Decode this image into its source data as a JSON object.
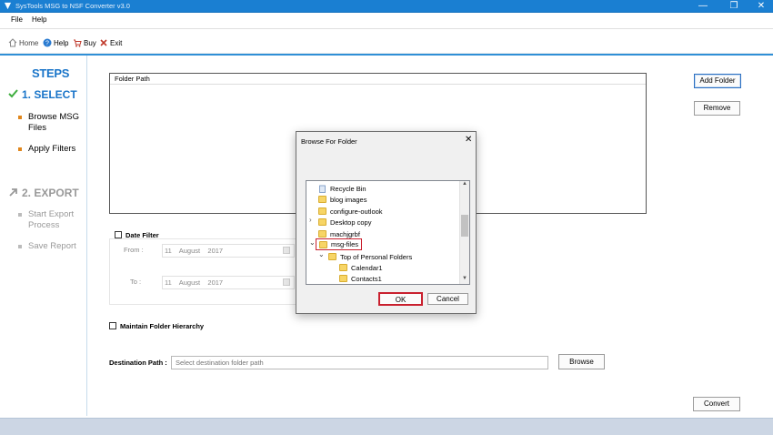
{
  "window": {
    "title": "SysTools MSG to NSF Converter v3.0",
    "controls": {
      "minimize": "—",
      "restore": "❐",
      "close": "✕"
    }
  },
  "menu": {
    "file": "File",
    "help": "Help"
  },
  "toolbar": {
    "home": "Home",
    "help": "Help",
    "buy": "Buy",
    "exit": "Exit"
  },
  "sidebar": {
    "steps_title": "STEPS",
    "step1": {
      "label": "1. SELECT",
      "items": [
        "Browse MSG Files",
        "Apply Filters"
      ]
    },
    "step2": {
      "label": "2. EXPORT",
      "items": [
        "Start Export Process",
        "Save Report"
      ]
    }
  },
  "main": {
    "folder_path_header": "Folder Path",
    "add_folder": "Add Folder",
    "remove": "Remove",
    "date_filter": {
      "label": "Date Filter",
      "from_label": "From :",
      "to_label": "To :",
      "from": {
        "day": "11",
        "month": "August",
        "year": "2017"
      },
      "to": {
        "day": "11",
        "month": "August",
        "year": "2017"
      }
    },
    "maintain_hierarchy": "Maintain Folder Hierarchy",
    "destination_label": "Destination Path :",
    "destination_placeholder": "Select destination folder path",
    "browse": "Browse",
    "convert": "Convert"
  },
  "dialog": {
    "title": "Browse For Folder",
    "close": "✕",
    "tree": [
      "Recycle Bin",
      "blog images",
      "configure-outlook",
      "Desktop copy",
      "machjgrbf",
      "msg-files",
      "Top of Personal Folders",
      "Calendar1",
      "Contacts1"
    ],
    "ok": "OK",
    "cancel": "Cancel"
  },
  "colors": {
    "accent": "#1a75c9",
    "titlebar": "#1a7fd2",
    "highlight": "#c9202e"
  }
}
